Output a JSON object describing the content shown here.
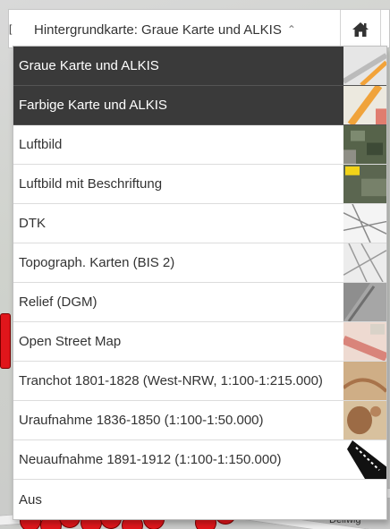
{
  "toolbar": {
    "basemap_label": "Hintergrundkarte: Graue Karte und ALKIS",
    "caret": "^"
  },
  "map": {
    "place_label": "Dellwig"
  },
  "menu": {
    "items": [
      {
        "label": "Graue Karte und ALKIS",
        "active": true
      },
      {
        "label": "Farbige Karte und ALKIS",
        "active": true
      },
      {
        "label": "Luftbild",
        "active": false
      },
      {
        "label": "Luftbild mit Beschriftung",
        "active": false
      },
      {
        "label": "DTK",
        "active": false
      },
      {
        "label": "Topograph. Karten (BIS 2)",
        "active": false
      },
      {
        "label": "Relief (DGM)",
        "active": false
      },
      {
        "label": "Open Street Map",
        "active": false
      },
      {
        "label": "Tranchot 1801-1828 (West-NRW, 1:100-1:215.000)",
        "active": false
      },
      {
        "label": "Uraufnahme 1836-1850 (1:100-1:50.000)",
        "active": false
      },
      {
        "label": "Neuaufnahme 1891-1912 (1:100-1:150.000)",
        "active": false
      },
      {
        "label": "Aus",
        "active": false
      }
    ]
  }
}
